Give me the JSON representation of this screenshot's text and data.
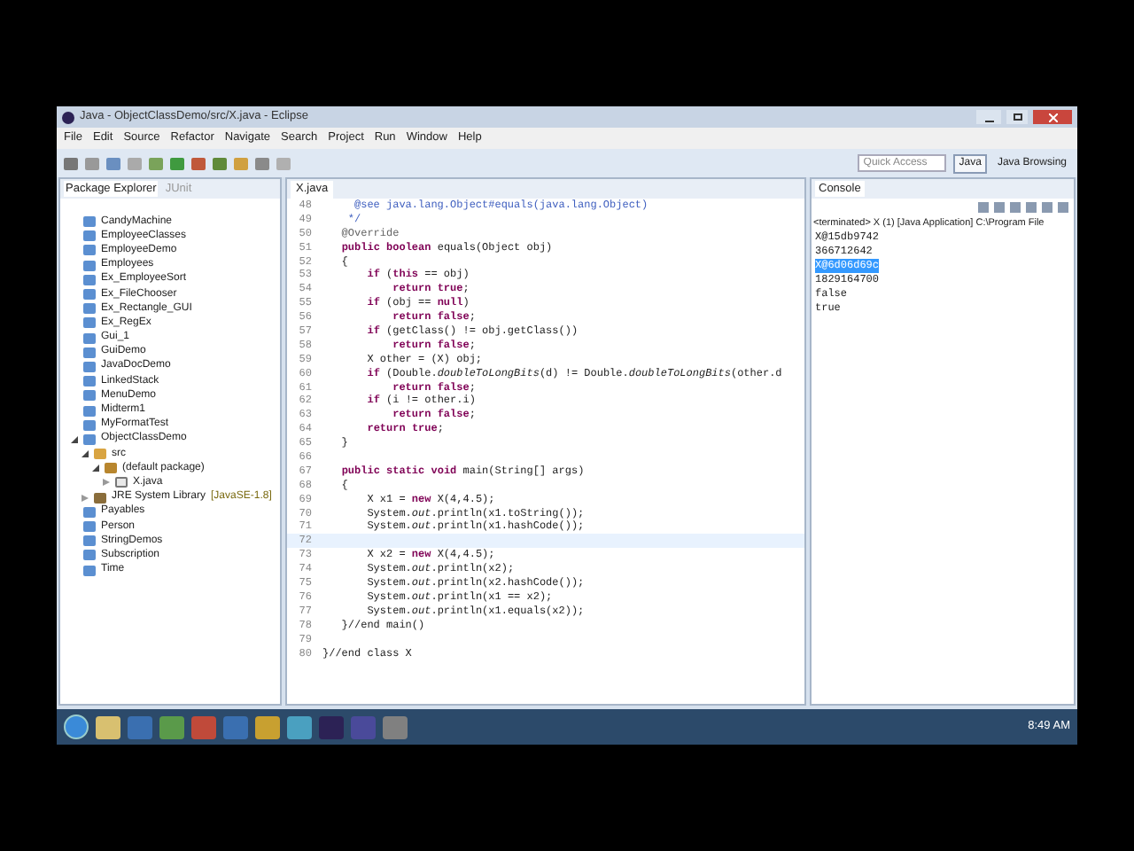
{
  "window": {
    "title": "Java - ObjectClassDemo/src/X.java - Eclipse"
  },
  "menu": [
    "File",
    "Edit",
    "Source",
    "Refactor",
    "Navigate",
    "Search",
    "Project",
    "Run",
    "Window",
    "Help"
  ],
  "quick_access": {
    "placeholder": "Quick Access"
  },
  "perspectives": [
    {
      "label": "Java",
      "selected": true
    },
    {
      "label": "Java Browsing",
      "selected": false
    }
  ],
  "left_tabs": [
    {
      "label": "Package Explorer",
      "selected": true
    },
    {
      "label": "JUnit",
      "selected": false
    }
  ],
  "tree": [
    {
      "label": "CandyMachine",
      "kind": "project"
    },
    {
      "label": "EmployeeClasses",
      "kind": "project"
    },
    {
      "label": "EmployeeDemo",
      "kind": "project"
    },
    {
      "label": "Employees",
      "kind": "project"
    },
    {
      "label": "Ex_EmployeeSort",
      "kind": "project"
    },
    {
      "label": "Ex_FileChooser",
      "kind": "project"
    },
    {
      "label": "Ex_Rectangle_GUI",
      "kind": "project"
    },
    {
      "label": "Ex_RegEx",
      "kind": "project"
    },
    {
      "label": "Gui_1",
      "kind": "project"
    },
    {
      "label": "GuiDemo",
      "kind": "project"
    },
    {
      "label": "JavaDocDemo",
      "kind": "project"
    },
    {
      "label": "LinkedStack",
      "kind": "project"
    },
    {
      "label": "MenuDemo",
      "kind": "project"
    },
    {
      "label": "Midterm1",
      "kind": "project"
    },
    {
      "label": "MyFormatTest",
      "kind": "project"
    },
    {
      "label": "ObjectClassDemo",
      "kind": "project",
      "expanded": true,
      "children": [
        {
          "label": "src",
          "kind": "folder",
          "expanded": true,
          "children": [
            {
              "label": "(default package)",
              "kind": "package",
              "expanded": true,
              "children": [
                {
                  "label": "X.java",
                  "kind": "file",
                  "expanded": false
                }
              ]
            }
          ]
        },
        {
          "label": "JRE System Library",
          "decoration": "[JavaSE-1.8]",
          "kind": "library",
          "expanded": false
        }
      ]
    },
    {
      "label": "Payables",
      "kind": "project"
    },
    {
      "label": "Person",
      "kind": "project"
    },
    {
      "label": "StringDemos",
      "kind": "project"
    },
    {
      "label": "Subscription",
      "kind": "project"
    },
    {
      "label": "Time",
      "kind": "project"
    }
  ],
  "editor": {
    "tab": "X.java",
    "lines": [
      {
        "n": "48",
        "code": "     @see java.lang.Object#equals(java.lang.Object)",
        "kind": "comment"
      },
      {
        "n": "49",
        "code": "    */",
        "kind": "comment"
      },
      {
        "n": "50",
        "code": "   @Override",
        "kind": "annotation"
      },
      {
        "n": "51",
        "code": "   **public** **boolean** equals(Object obj)",
        "kind": "code"
      },
      {
        "n": "52",
        "code": "   {",
        "kind": "code"
      },
      {
        "n": "53",
        "code": "       **if** (**this** == obj)",
        "kind": "code"
      },
      {
        "n": "54",
        "code": "           **return** **true**;",
        "kind": "code"
      },
      {
        "n": "55",
        "code": "       **if** (obj == **null**)",
        "kind": "code"
      },
      {
        "n": "56",
        "code": "           **return** **false**;",
        "kind": "code"
      },
      {
        "n": "57",
        "code": "       **if** (getClass() != obj.getClass())",
        "kind": "code"
      },
      {
        "n": "58",
        "code": "           **return** **false**;",
        "kind": "code"
      },
      {
        "n": "59",
        "code": "       X other = (X) obj;",
        "kind": "code"
      },
      {
        "n": "60",
        "code": "       **if** (Double.*doubleToLongBits*(d) != Double.*doubleToLongBits*(other.d",
        "kind": "code"
      },
      {
        "n": "61",
        "code": "           **return** **false**;",
        "kind": "code"
      },
      {
        "n": "62",
        "code": "       **if** (i != other.i)",
        "kind": "code"
      },
      {
        "n": "63",
        "code": "           **return** **false**;",
        "kind": "code"
      },
      {
        "n": "64",
        "code": "       **return** **true**;",
        "kind": "code"
      },
      {
        "n": "65",
        "code": "   }",
        "kind": "code"
      },
      {
        "n": "66",
        "kind": "code"
      },
      {
        "n": "67",
        "code": "   **public** **static** **void** main(String[] args)",
        "kind": "code"
      },
      {
        "n": "68",
        "code": "   {",
        "kind": "code"
      },
      {
        "n": "69",
        "code": "       X x1 = **new** X(4,4.5);",
        "kind": "code"
      },
      {
        "n": "70",
        "code": "       System.*out*.println(x1.toString());",
        "kind": "code"
      },
      {
        "n": "71",
        "code": "       System.*out*.println(x1.hashCode());",
        "kind": "code"
      },
      {
        "n": "72",
        "kind": "code",
        "current": true
      },
      {
        "n": "73",
        "code": "       X x2 = **new** X(4,4.5);",
        "kind": "code"
      },
      {
        "n": "74",
        "code": "       System.*out*.println(x2);",
        "kind": "code"
      },
      {
        "n": "75",
        "code": "       System.*out*.println(x2.hashCode());",
        "kind": "code"
      },
      {
        "n": "76",
        "code": "       System.*out*.println(x1 == x2);",
        "kind": "code"
      },
      {
        "n": "77",
        "code": "       System.*out*.println(x1.equals(x2));",
        "kind": "code"
      },
      {
        "n": "78",
        "code": "   }//end main()",
        "kind": "code"
      },
      {
        "n": "79",
        "kind": "code"
      },
      {
        "n": "80",
        "code": "}//end class X",
        "kind": "code"
      }
    ]
  },
  "console": {
    "tab": "Console",
    "header": "<terminated> X (1) [Java Application] C:\\Program File",
    "lines": [
      {
        "text": "X@15db9742",
        "selected": false
      },
      {
        "text": "366712642",
        "selected": false
      },
      {
        "text": "X@6d06d69c",
        "selected": true
      },
      {
        "text": "1829164700",
        "selected": false
      },
      {
        "text": "false",
        "selected": false
      },
      {
        "text": "true",
        "selected": false
      }
    ]
  },
  "taskbar": {
    "time": "8:49 AM"
  }
}
